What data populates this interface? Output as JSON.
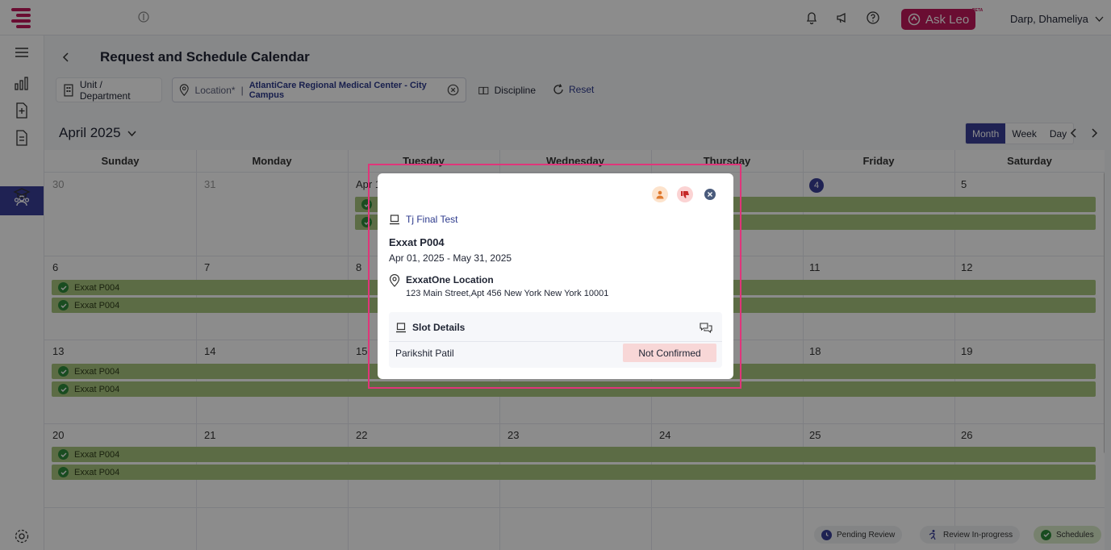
{
  "header": {
    "ask_leo_label": "Ask Leo",
    "beta_badge": "BETA",
    "user_name": "Darp, Dhameliya"
  },
  "page": {
    "title": "Request and Schedule Calendar"
  },
  "filters": {
    "unit_department": "Unit / Department",
    "location_label": "Location*",
    "location_separator": "|",
    "location_value": "AtlantiCare Regional Medical Center - City Campus",
    "discipline": "Discipline",
    "reset": "Reset"
  },
  "calendar": {
    "month_label": "April 2025",
    "views": [
      "Month",
      "Week",
      "Day"
    ],
    "active_view": "Month",
    "weekdays": [
      "Sunday",
      "Monday",
      "Tuesday",
      "Wednesday",
      "Thursday",
      "Friday",
      "Saturday"
    ],
    "week1": [
      "30",
      "31",
      "Apr 1",
      "",
      "",
      "4",
      "5"
    ],
    "week2": [
      "6",
      "7",
      "8",
      "",
      "",
      "11",
      "12"
    ],
    "week3": [
      "13",
      "14",
      "15",
      "",
      "",
      "18",
      "19"
    ],
    "week4": [
      "20",
      "21",
      "22",
      "23",
      "24",
      "25",
      "26"
    ],
    "event_label": "Exxat P004"
  },
  "legend": {
    "pending": "Pending Review",
    "in_progress": "Review In-progress",
    "schedules": "Schedules"
  },
  "popup": {
    "course": "Tj Final Test",
    "name": "Exxat P004",
    "dates": "Apr 01, 2025 - May 31, 2025",
    "location_name": "ExxatOne Location",
    "location_address": "123 Main Street,Apt 456 New York New York 10001",
    "slot_title": "Slot Details",
    "person": "Parikshit Patil",
    "status": "Not Confirmed"
  },
  "colors": {
    "brand": "#c2185b",
    "primary": "#3a3f98",
    "event": "#a8c57e",
    "status_not_confirmed": "#f8d7d7",
    "highlight": "#e0357a"
  }
}
